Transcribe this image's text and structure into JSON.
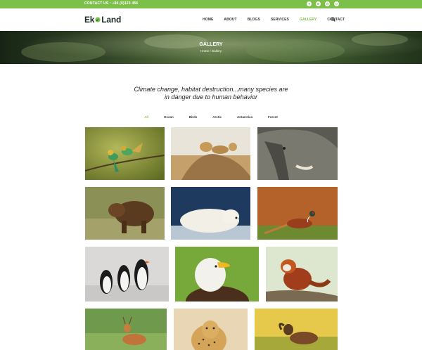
{
  "topbar": {
    "contact": "CONTACT US : +84 (0)123 456",
    "socials": [
      "facebook-icon",
      "twitter-icon",
      "instagram-icon",
      "pinterest-icon"
    ]
  },
  "header": {
    "logo_left": "Ek",
    "logo_right": "Land",
    "nav": [
      {
        "label": "HOME",
        "active": false
      },
      {
        "label": "ABOUT",
        "active": false
      },
      {
        "label": "BLOGS",
        "active": false
      },
      {
        "label": "SERVICES",
        "active": false
      },
      {
        "label": "GALLERY",
        "active": true
      },
      {
        "label": "CONTACT",
        "active": false
      }
    ]
  },
  "hero": {
    "title": "GALLERY",
    "breadcrumb": "Home / Gallery"
  },
  "tagline": {
    "line1": "Climate change, habitat destruction...many species are",
    "line2": "in danger due to human behavior"
  },
  "filters": [
    {
      "label": "All",
      "active": true
    },
    {
      "label": "Ocean",
      "active": false
    },
    {
      "label": "Birds",
      "active": false
    },
    {
      "label": "Arctic",
      "active": false
    },
    {
      "label": "Antarctica",
      "active": false
    },
    {
      "label": "Forest",
      "active": false
    }
  ],
  "colors": {
    "accent": "#7cc04a",
    "text_dark": "#222222"
  },
  "gallery": [
    "bee-eater-birds",
    "lions",
    "elephant",
    "brown-bear",
    "polar-bear",
    "pheasant",
    "penguins",
    "bald-eagle",
    "red-panda",
    "deer",
    "cheetah",
    "mountain-goat"
  ]
}
